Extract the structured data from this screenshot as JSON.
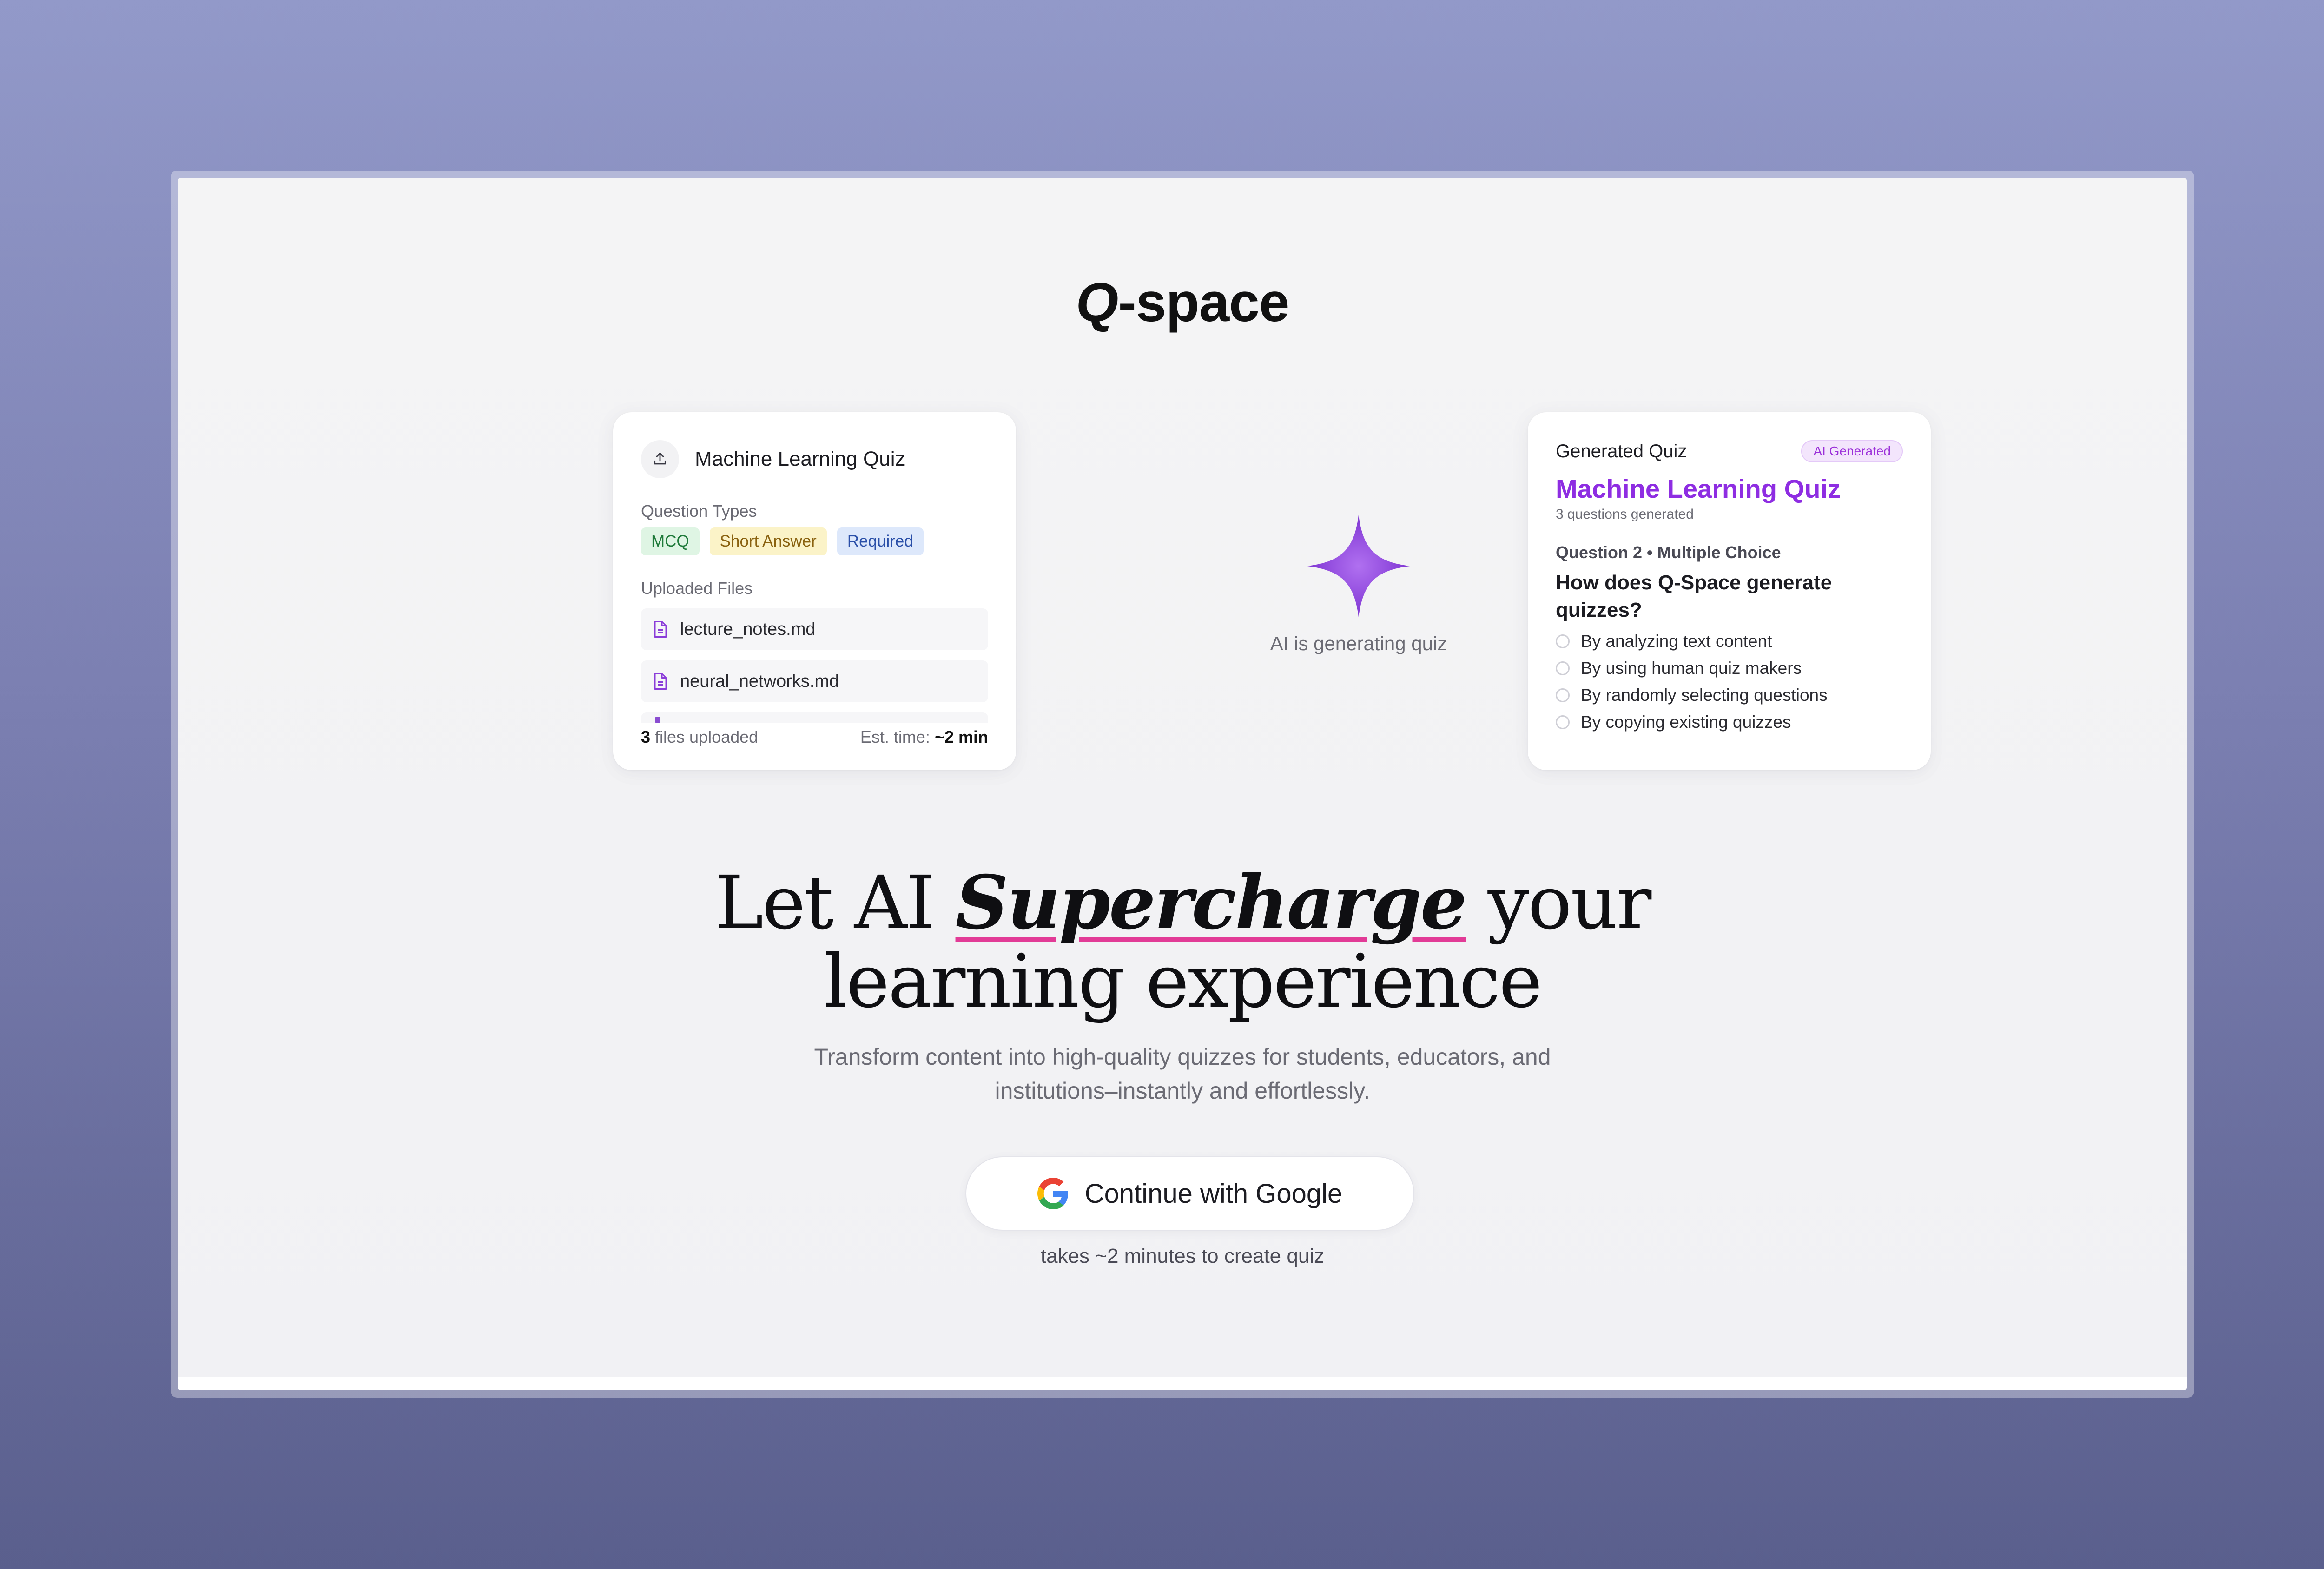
{
  "logo": {
    "q": "Q",
    "rest": "-space"
  },
  "upload_card": {
    "title": "Machine Learning Quiz",
    "question_types_label": "Question Types",
    "chips": [
      "MCQ",
      "Short Answer",
      "Required"
    ],
    "files_label": "Uploaded Files",
    "files": [
      "lecture_notes.md",
      "neural_networks.md"
    ],
    "footer": {
      "count": "3",
      "count_suffix": " files uploaded",
      "est_label": "Est. time: ",
      "est_value": "~2 min"
    }
  },
  "center": {
    "status": "AI is generating quiz",
    "spark_color": "#8b3dd9"
  },
  "quiz_card": {
    "label": "Generated Quiz",
    "badge": "AI Generated",
    "title": "Machine Learning Quiz",
    "subtitle": "3 questions generated",
    "question_meta": "Question 2 • Multiple Choice",
    "question": "How does Q-Space generate quizzes?",
    "options": [
      "By analyzing text content",
      "By using human quiz makers",
      "By randomly selecting questions",
      "By copying existing quizzes"
    ]
  },
  "hero": {
    "line1_pre": "Let AI ",
    "line1_em": "Supercharge",
    "line1_post": " your",
    "line2": "learning experience",
    "underline_color": "#e23b96"
  },
  "subtext": {
    "line1": "Transform content into high-quality quizzes for students, educators, and",
    "line2": "institutions–instantly and effortlessly."
  },
  "cta": {
    "label": "Continue with Google",
    "note": "takes ~2 minutes to create quiz"
  }
}
